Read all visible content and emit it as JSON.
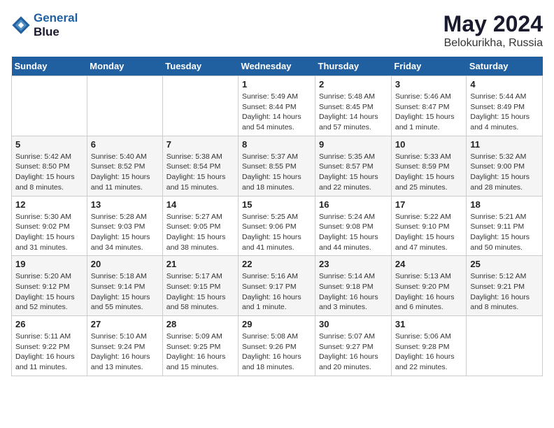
{
  "logo": {
    "line1": "General",
    "line2": "Blue"
  },
  "title": "May 2024",
  "location": "Belokurikha, Russia",
  "weekdays": [
    "Sunday",
    "Monday",
    "Tuesday",
    "Wednesday",
    "Thursday",
    "Friday",
    "Saturday"
  ],
  "rows": [
    [
      {
        "day": "",
        "info": ""
      },
      {
        "day": "",
        "info": ""
      },
      {
        "day": "",
        "info": ""
      },
      {
        "day": "1",
        "info": "Sunrise: 5:49 AM\nSunset: 8:44 PM\nDaylight: 14 hours\nand 54 minutes."
      },
      {
        "day": "2",
        "info": "Sunrise: 5:48 AM\nSunset: 8:45 PM\nDaylight: 14 hours\nand 57 minutes."
      },
      {
        "day": "3",
        "info": "Sunrise: 5:46 AM\nSunset: 8:47 PM\nDaylight: 15 hours\nand 1 minute."
      },
      {
        "day": "4",
        "info": "Sunrise: 5:44 AM\nSunset: 8:49 PM\nDaylight: 15 hours\nand 4 minutes."
      }
    ],
    [
      {
        "day": "5",
        "info": "Sunrise: 5:42 AM\nSunset: 8:50 PM\nDaylight: 15 hours\nand 8 minutes."
      },
      {
        "day": "6",
        "info": "Sunrise: 5:40 AM\nSunset: 8:52 PM\nDaylight: 15 hours\nand 11 minutes."
      },
      {
        "day": "7",
        "info": "Sunrise: 5:38 AM\nSunset: 8:54 PM\nDaylight: 15 hours\nand 15 minutes."
      },
      {
        "day": "8",
        "info": "Sunrise: 5:37 AM\nSunset: 8:55 PM\nDaylight: 15 hours\nand 18 minutes."
      },
      {
        "day": "9",
        "info": "Sunrise: 5:35 AM\nSunset: 8:57 PM\nDaylight: 15 hours\nand 22 minutes."
      },
      {
        "day": "10",
        "info": "Sunrise: 5:33 AM\nSunset: 8:59 PM\nDaylight: 15 hours\nand 25 minutes."
      },
      {
        "day": "11",
        "info": "Sunrise: 5:32 AM\nSunset: 9:00 PM\nDaylight: 15 hours\nand 28 minutes."
      }
    ],
    [
      {
        "day": "12",
        "info": "Sunrise: 5:30 AM\nSunset: 9:02 PM\nDaylight: 15 hours\nand 31 minutes."
      },
      {
        "day": "13",
        "info": "Sunrise: 5:28 AM\nSunset: 9:03 PM\nDaylight: 15 hours\nand 34 minutes."
      },
      {
        "day": "14",
        "info": "Sunrise: 5:27 AM\nSunset: 9:05 PM\nDaylight: 15 hours\nand 38 minutes."
      },
      {
        "day": "15",
        "info": "Sunrise: 5:25 AM\nSunset: 9:06 PM\nDaylight: 15 hours\nand 41 minutes."
      },
      {
        "day": "16",
        "info": "Sunrise: 5:24 AM\nSunset: 9:08 PM\nDaylight: 15 hours\nand 44 minutes."
      },
      {
        "day": "17",
        "info": "Sunrise: 5:22 AM\nSunset: 9:10 PM\nDaylight: 15 hours\nand 47 minutes."
      },
      {
        "day": "18",
        "info": "Sunrise: 5:21 AM\nSunset: 9:11 PM\nDaylight: 15 hours\nand 50 minutes."
      }
    ],
    [
      {
        "day": "19",
        "info": "Sunrise: 5:20 AM\nSunset: 9:12 PM\nDaylight: 15 hours\nand 52 minutes."
      },
      {
        "day": "20",
        "info": "Sunrise: 5:18 AM\nSunset: 9:14 PM\nDaylight: 15 hours\nand 55 minutes."
      },
      {
        "day": "21",
        "info": "Sunrise: 5:17 AM\nSunset: 9:15 PM\nDaylight: 15 hours\nand 58 minutes."
      },
      {
        "day": "22",
        "info": "Sunrise: 5:16 AM\nSunset: 9:17 PM\nDaylight: 16 hours\nand 1 minute."
      },
      {
        "day": "23",
        "info": "Sunrise: 5:14 AM\nSunset: 9:18 PM\nDaylight: 16 hours\nand 3 minutes."
      },
      {
        "day": "24",
        "info": "Sunrise: 5:13 AM\nSunset: 9:20 PM\nDaylight: 16 hours\nand 6 minutes."
      },
      {
        "day": "25",
        "info": "Sunrise: 5:12 AM\nSunset: 9:21 PM\nDaylight: 16 hours\nand 8 minutes."
      }
    ],
    [
      {
        "day": "26",
        "info": "Sunrise: 5:11 AM\nSunset: 9:22 PM\nDaylight: 16 hours\nand 11 minutes."
      },
      {
        "day": "27",
        "info": "Sunrise: 5:10 AM\nSunset: 9:24 PM\nDaylight: 16 hours\nand 13 minutes."
      },
      {
        "day": "28",
        "info": "Sunrise: 5:09 AM\nSunset: 9:25 PM\nDaylight: 16 hours\nand 15 minutes."
      },
      {
        "day": "29",
        "info": "Sunrise: 5:08 AM\nSunset: 9:26 PM\nDaylight: 16 hours\nand 18 minutes."
      },
      {
        "day": "30",
        "info": "Sunrise: 5:07 AM\nSunset: 9:27 PM\nDaylight: 16 hours\nand 20 minutes."
      },
      {
        "day": "31",
        "info": "Sunrise: 5:06 AM\nSunset: 9:28 PM\nDaylight: 16 hours\nand 22 minutes."
      },
      {
        "day": "",
        "info": ""
      }
    ]
  ]
}
